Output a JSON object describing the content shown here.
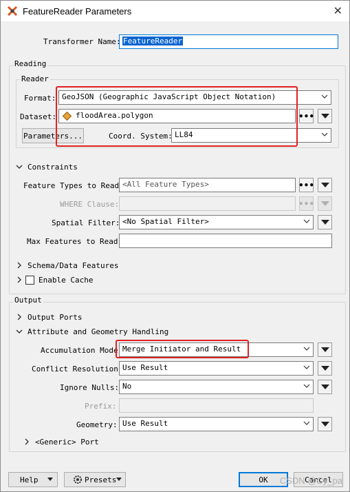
{
  "window": {
    "title": "FeatureReader Parameters"
  },
  "transformer": {
    "name_label": "Transformer Name:",
    "name_value": "FeatureReader"
  },
  "reading": {
    "section_label": "Reading",
    "reader_label": "Reader",
    "format_label": "Format:",
    "format_value": "GeoJSON (Geographic JavaScript Object Notation)",
    "dataset_label": "Dataset:",
    "dataset_value": "floodArea.polygon",
    "parameters_button": "Parameters...",
    "coord_label": "Coord. System:",
    "coord_value": "LL84"
  },
  "constraints": {
    "header": "Constraints",
    "feature_types_label": "Feature Types to Read:",
    "feature_types_placeholder": "<All Feature Types>",
    "where_label": "WHERE Clause:",
    "spatial_filter_label": "Spatial Filter:",
    "spatial_filter_value": "<No Spatial Filter>",
    "max_features_label": "Max Features to Read:"
  },
  "schema": {
    "header": "Schema/Data Features"
  },
  "cache": {
    "label": "Enable Cache"
  },
  "output": {
    "section_label": "Output",
    "ports_header": "Output Ports",
    "attr_header": "Attribute and Geometry Handling",
    "accumulation_label": "Accumulation Mode:",
    "accumulation_value": "Merge Initiator and Result",
    "conflict_label": "Conflict Resolution:",
    "conflict_value": "Use Result",
    "ignore_nulls_label": "Ignore Nulls:",
    "ignore_nulls_value": "No",
    "prefix_label": "Prefix:",
    "geometry_label": "Geometry:",
    "geometry_value": "Use Result",
    "generic_port_header": "<Generic> Port"
  },
  "footer": {
    "help_button": "Help",
    "presets_button": "Presets",
    "ok_button": "OK",
    "cancel_button": "Cancel",
    "watermark": "CSDN @Cy_pa"
  },
  "colors": {
    "highlight_border": "#e02020",
    "selection": "#0a64d2",
    "accent": "#0078d7"
  },
  "icons": [
    "fme-app-icon",
    "close-icon",
    "dataset-diamond-icon",
    "presets-gear-icon"
  ]
}
